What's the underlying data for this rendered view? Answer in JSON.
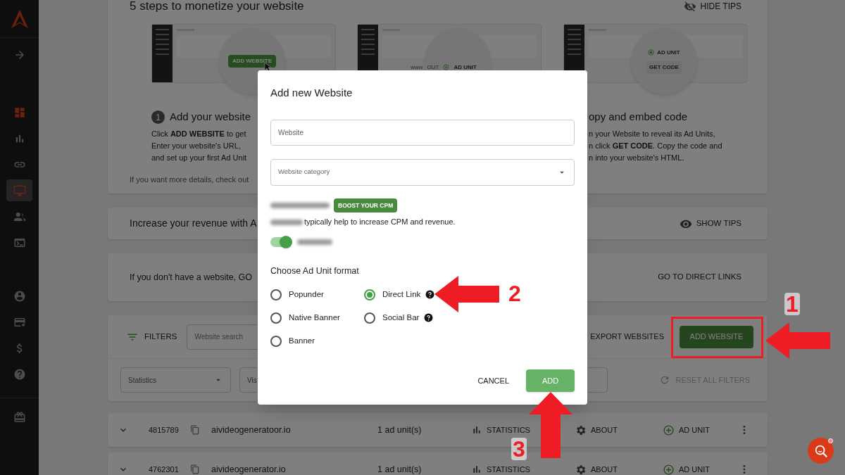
{
  "sidebar": {
    "items": [
      {
        "selected": false
      },
      {
        "selected": false
      },
      {
        "selected": false
      },
      {
        "selected": true
      },
      {
        "selected": false
      },
      {
        "selected": false
      }
    ],
    "account_items": [
      {
        "selected": false
      },
      {
        "selected": false
      },
      {
        "selected": false
      },
      {
        "selected": false
      }
    ]
  },
  "tips": {
    "title": "5 steps to monetize your website",
    "hide_label": "HIDE TIPS",
    "steps": [
      {
        "number": "1",
        "title": "Add your website",
        "lines": [
          "Click **ADD WEBSITE** to get",
          "Enter your website's URL,",
          "and set up your first Ad Unit"
        ],
        "mockup_labels": [
          "ADD WEBSITE"
        ]
      },
      {
        "mockup_labels": [
          "www",
          "OUT",
          "AD UNIT"
        ]
      },
      {
        "title": "opy and embed code",
        "lines": [
          "n your Website to reveal its Ad Units,",
          "n click **GET CODE**. Copy the code and",
          "n into your website's HTML."
        ],
        "mockup_labels": [
          "AD UNIT",
          "GET CODE"
        ]
      }
    ],
    "footer": "If you want more details, check out"
  },
  "revenue_banner": {
    "text": "Increase your revenue with A",
    "action": "SHOW TIPS"
  },
  "direct_links_banner": {
    "text": "If you don't have a website, GO",
    "action": "GO TO DIRECT LINKS"
  },
  "filters": {
    "label": "FILTERS",
    "search_placeholder": "Website search",
    "export": "EXPORT WEBSITES",
    "add": "ADD WEBSITE",
    "selects": [
      "Statistics",
      "Vis"
    ],
    "reset": "RESET ALL FILTERS"
  },
  "websites": [
    {
      "id": "4815789",
      "domain": "aivideogeneratoor.io",
      "units": "1 ad unit(s)",
      "statistics": "STATISTICS",
      "about": "ABOUT",
      "ad_unit": "AD UNIT"
    },
    {
      "id": "4762301",
      "domain": "aivideogenerator.io",
      "units": "1 ad unit(s)",
      "statistics": "STATISTICS",
      "about": "ABOUT",
      "ad_unit": "AD UNIT"
    }
  ],
  "dialog": {
    "title": "Add new Website",
    "website_placeholder": "Website",
    "category_placeholder": "Website category",
    "boost_badge": "BOOST YOUR CPM",
    "adult_note": "typically help to increase CPM and revenue.",
    "adult_toggle": {
      "on": true
    },
    "format_heading": "Choose Ad Unit format",
    "formats": [
      {
        "label": "Popunder",
        "selected": false,
        "help": false
      },
      {
        "label": "Direct Link",
        "selected": true,
        "help": true
      },
      {
        "label": "Native Banner",
        "selected": false,
        "help": false
      },
      {
        "label": "Social Bar",
        "selected": false,
        "help": true
      },
      {
        "label": "Banner",
        "selected": false,
        "help": false
      }
    ],
    "buttons": [
      {
        "label": "CANCEL",
        "kind": "text"
      },
      {
        "label": "ADD",
        "kind": "primary"
      }
    ]
  },
  "annotations": [
    {
      "label": "1"
    },
    {
      "label": "2"
    },
    {
      "label": "3"
    }
  ]
}
